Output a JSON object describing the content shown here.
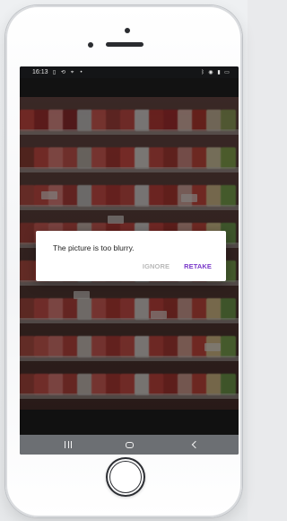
{
  "status_bar": {
    "time": "16:13",
    "left_icons": [
      "sim-icon",
      "sync-icon",
      "location-icon",
      "dot-icon"
    ],
    "right_icons": [
      "bluetooth-icon",
      "location-icon",
      "signal-icon",
      "battery-icon"
    ]
  },
  "dialog": {
    "message": "The picture is too blurry.",
    "actions": {
      "ignore": "IGNORE",
      "retake": "RETAKE"
    },
    "colors": {
      "ignore": "#b8b8b8",
      "retake": "#7a39c9"
    }
  },
  "navigation": {
    "recent": "recent-apps-icon",
    "home": "home-icon",
    "back": "back-icon"
  }
}
